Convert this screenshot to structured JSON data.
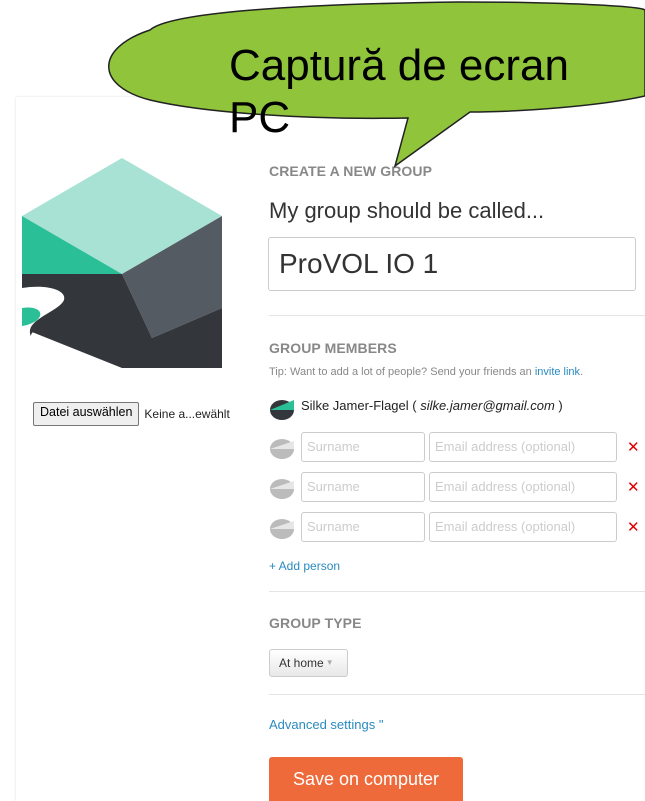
{
  "callout": {
    "text_line1": "Captură de ecran",
    "text_line2": "PC"
  },
  "upload": {
    "button_label": "Datei auswählen",
    "status": "Keine a...ewählt"
  },
  "create_group": {
    "section_title": "CREATE A NEW GROUP",
    "name_label": "My group should be called...",
    "name_value": "ProVOL IO 1"
  },
  "members": {
    "section_title": "GROUP MEMBERS",
    "tip_text": "Tip: Want to add a lot of people? Send your friends an",
    "tip_link": "invite link",
    "tip_end": ".",
    "owner_name": "Silke Jamer-Flagel",
    "owner_email": "silke.jamer@gmail.com",
    "surname_placeholder": "Surname",
    "email_placeholder": "Email address (optional)",
    "remove_symbol": "✕",
    "add_person": "+ Add person"
  },
  "group_type": {
    "section_title": "GROUP TYPE",
    "selected": "At home",
    "caret": "▼"
  },
  "advanced": {
    "label": "Advanced settings \""
  },
  "save": {
    "label": "Save on computer"
  },
  "colors": {
    "accent": "#ef6a3a",
    "link": "#2a8ac0",
    "remove": "#dd0000",
    "callout": "#8fc43b"
  }
}
